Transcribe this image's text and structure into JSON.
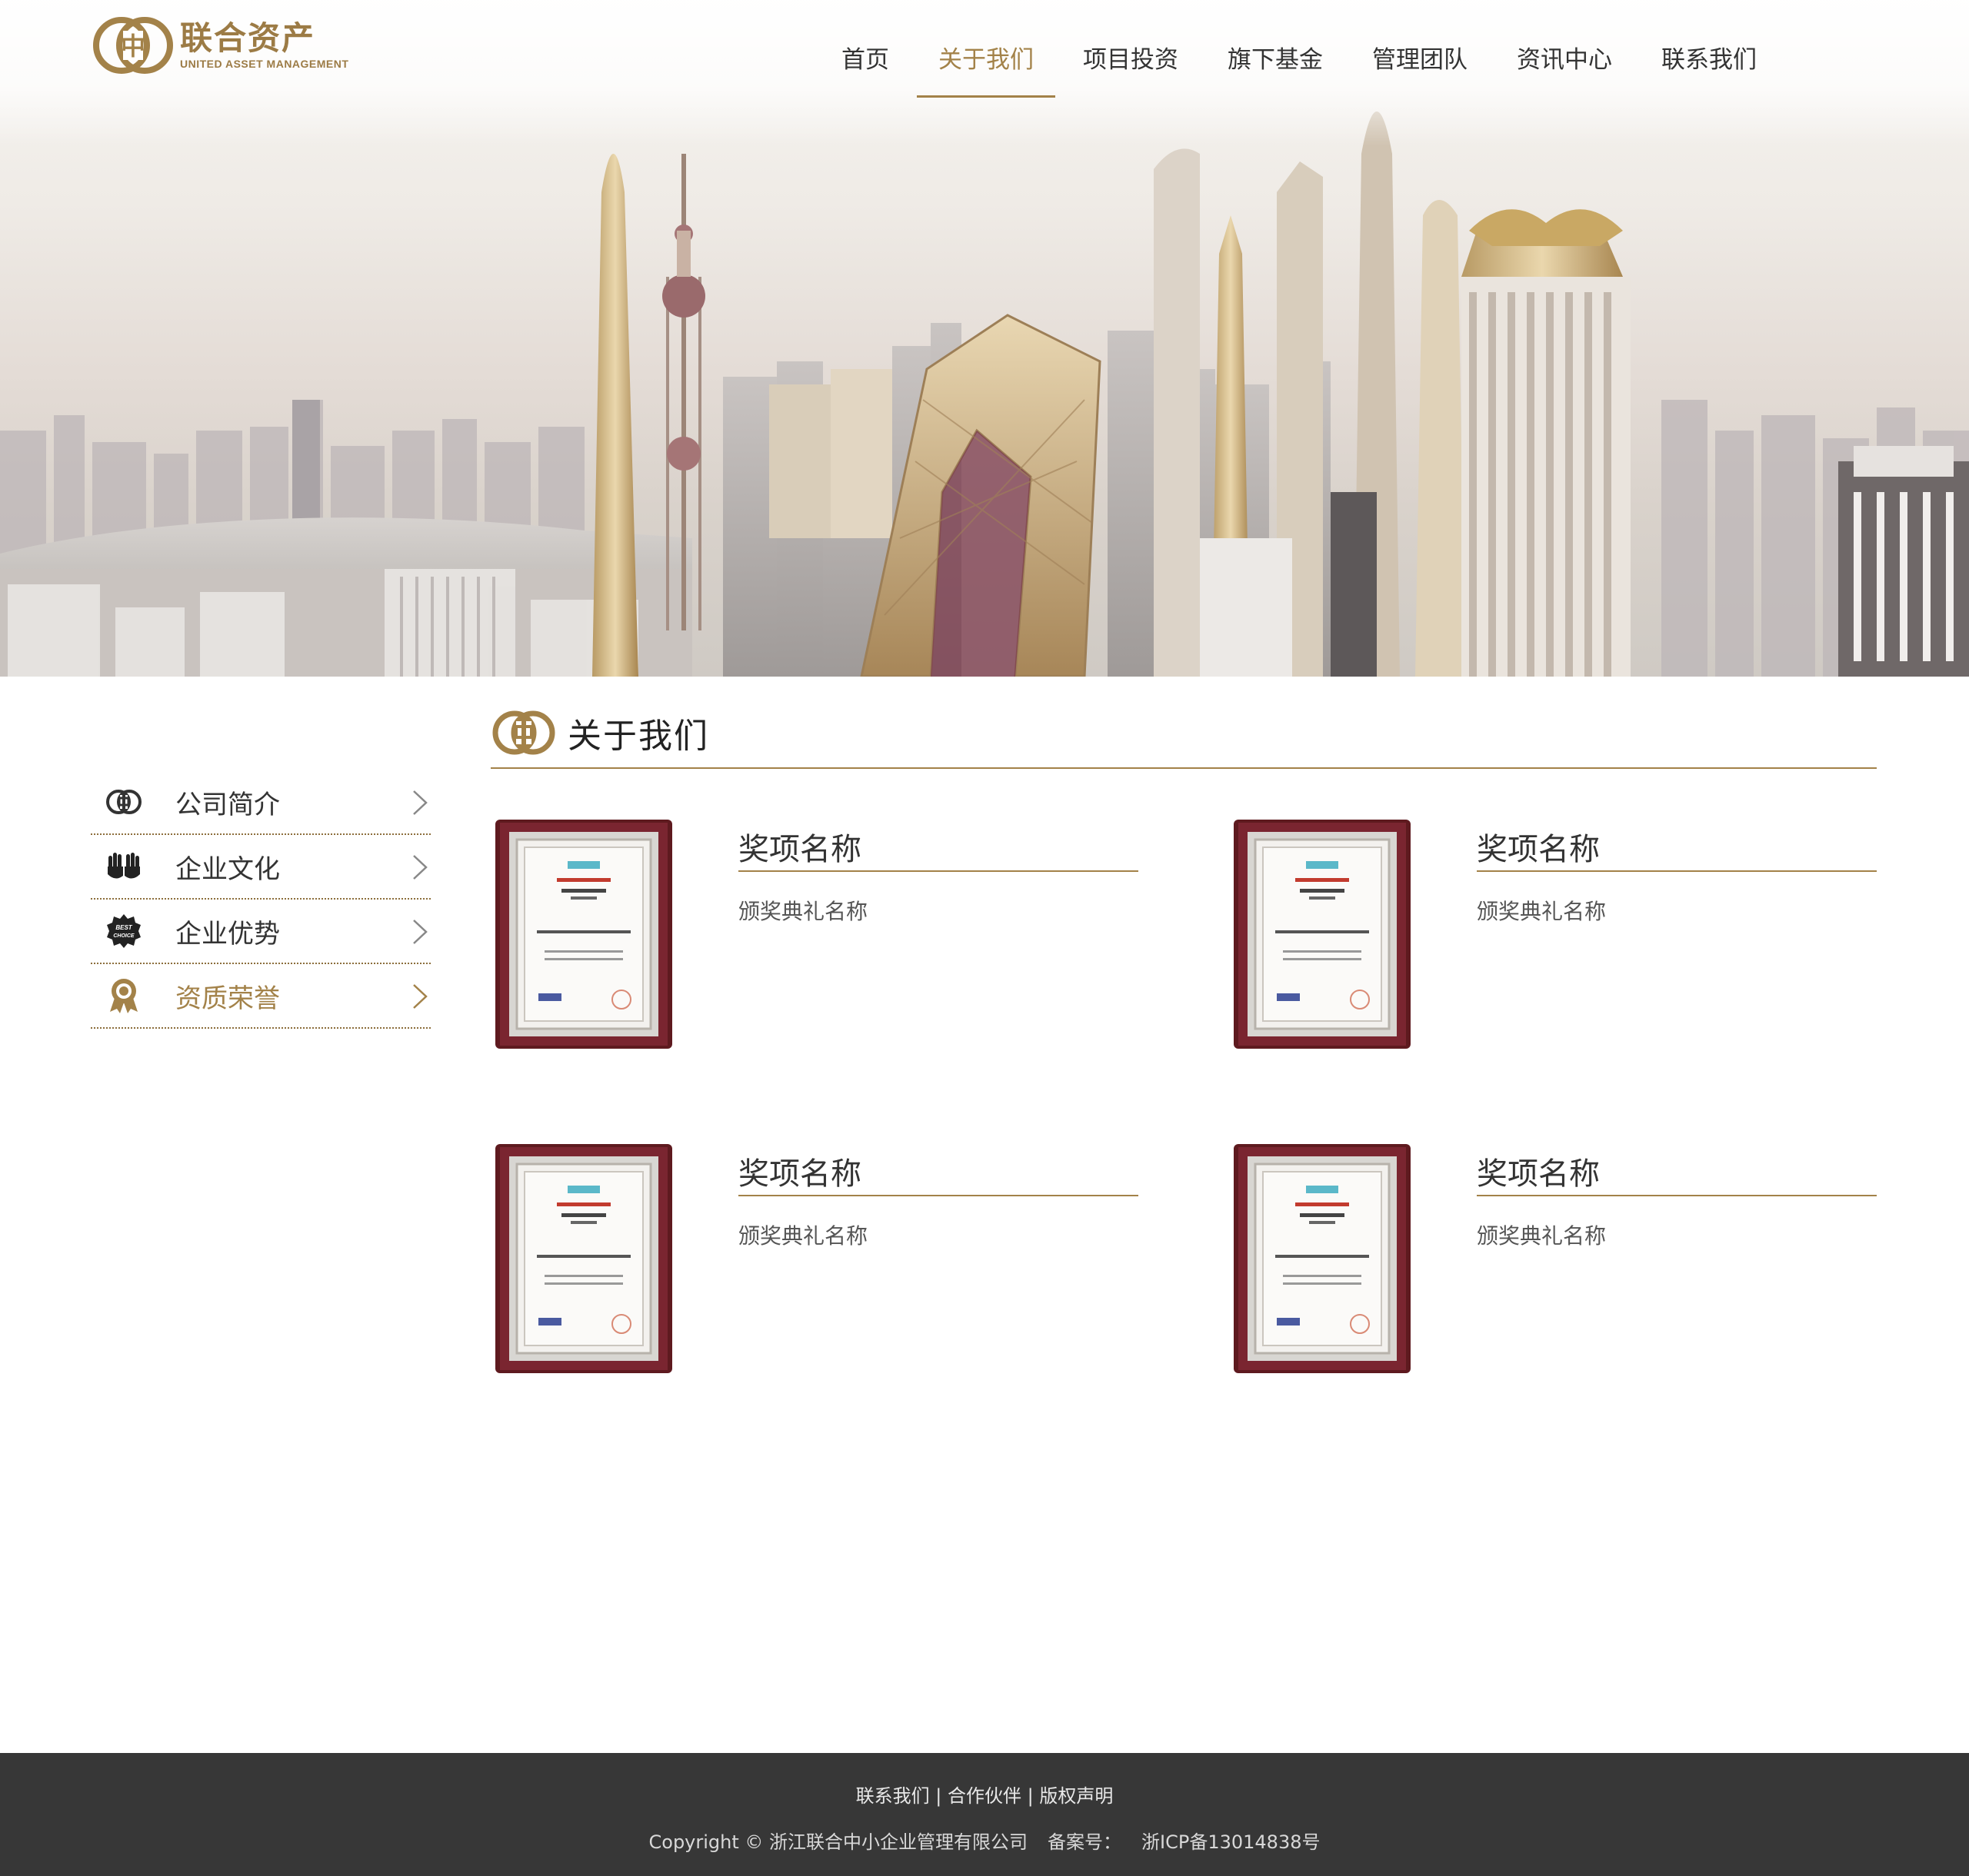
{
  "brand": {
    "name_cn": "联合资产",
    "name_en": "UNITED ASSET MANAGEMENT",
    "color": "#a38249"
  },
  "nav": {
    "items": [
      {
        "label": "首页"
      },
      {
        "label": "关于我们",
        "active": true
      },
      {
        "label": "项目投资"
      },
      {
        "label": "旗下基金"
      },
      {
        "label": "管理团队"
      },
      {
        "label": "资讯中心"
      },
      {
        "label": "联系我们"
      }
    ]
  },
  "sidebar": {
    "items": [
      {
        "label": "公司简介",
        "icon": "company-logo-icon"
      },
      {
        "label": "企业文化",
        "icon": "hands-icon"
      },
      {
        "label": "企业优势",
        "icon": "best-choice-badge-icon",
        "badge_text_1": "BEST",
        "badge_text_2": "CHOICE"
      },
      {
        "label": "资质荣誉",
        "icon": "award-ribbon-icon",
        "active": true
      }
    ]
  },
  "section": {
    "title": "关于我们"
  },
  "awards": [
    {
      "title": "奖项名称",
      "subtitle": "颁奖典礼名称"
    },
    {
      "title": "奖项名称",
      "subtitle": "颁奖典礼名称"
    },
    {
      "title": "奖项名称",
      "subtitle": "颁奖典礼名称"
    },
    {
      "title": "奖项名称",
      "subtitle": "颁奖典礼名称"
    }
  ],
  "footer": {
    "link_contact": "联系我们",
    "link_partners": "合作伙伴",
    "link_copyright": "版权声明",
    "separator": " | ",
    "copyright": "Copyright © 浙江联合中小企业管理有限公司",
    "icp_label": "备案号：",
    "icp_value": "浙ICP备13014838号",
    "bg_color": "#373737"
  }
}
